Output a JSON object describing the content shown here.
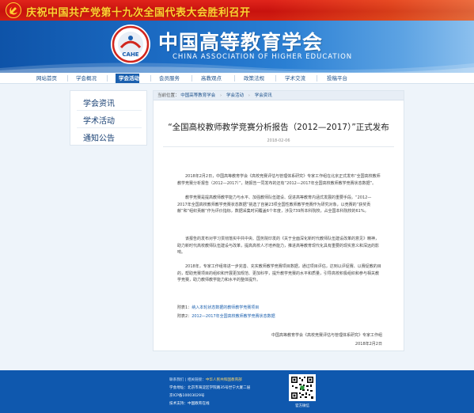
{
  "banner": {
    "text": "庆祝中国共产党第十九次全国代表大会胜利召开"
  },
  "header": {
    "title": "中国高等教育学会",
    "subtitle": "CHINA ASSOCIATION OF HIGHER EDUCATION",
    "logo_text": "CAHE"
  },
  "nav": {
    "items": [
      "网站首页",
      "学会概况",
      "学会活动",
      "会员服务",
      "高教观点",
      "政策法规",
      "学术交流",
      "投稿平台"
    ],
    "active": "学会活动"
  },
  "sidebar": {
    "items": [
      "学会资讯",
      "学术活动",
      "通知公告"
    ]
  },
  "breadcrumb": {
    "prefix": "当前位置：",
    "items": [
      "中国高等教育学会",
      "学会活动",
      "学会资讯"
    ]
  },
  "article": {
    "title": "“全国高校教师教学竞赛分析报告（2012—2017）”正式发布",
    "date": "2018-02-06",
    "paragraphs": [
      "2018年2月2日，中国高等教育学会《高校竞赛评估与管理体系研究》专家工作组在北京正式发布“全国高校教师教学竞赛分析报告（2012—2017）”，随报告一同发布的还有“2012—2017年全国高校教师教学竞赛状态数据”。",
      "教学竞赛是提高教师教学能力与水平、加强教师队伍建设、促进高等教育内涵式发展的重要手段。“2012—2017年全国高校教师教学竞赛状态数据”挑选了自第23项全国性教师教学竞赛作为研究对象，以竞赛的“获奖贡献”和“组织贡献”作为评价指标，数据采集时间覆盖6个年度，涉及739所本科院校，占全国本科院校的61%。",
      "该报告的发布对学习贯彻落实中共中央、国务院印发的《关于全面深化新时代教师队伍建设改革的意见》精神，助力新时代高校教师队伍建设与改革，提高高校人才培养能力，推进高等教育现代化具有重要的现实意义和深远的影响。",
      "2018年，专家工作组将进一步完善、充实教师教学竞赛项目数据，通过项目评估，达到以评促赛、以赛促教的目的，帮助竞赛项目的组织和开展更加规范、更加科学，提升教学竞赛的水平和质量，引导高校积极组织和参与相关教学竞赛，助力教师教学能力和水平的整体提升。"
    ],
    "attachments": [
      {
        "prefix": "附表1：",
        "link": "纳入本轮状态数据的教师教学竞赛项目"
      },
      {
        "prefix": "附表2：",
        "link": "2012—2017年全国高校教师教学竞赛状态数据"
      }
    ],
    "signature": "中国高等教育学会《高校竞赛评估与管理体系研究》专家工作组",
    "sign_date": "2018年2月2日"
  },
  "footer": {
    "links_label": "联系我们 | 相关链接：",
    "links_value": "中华人民共和国教育部",
    "address_label": "学会地址：",
    "address_value": "北京市海淀区学院路35号世宁大厦二层",
    "icp": "京ICP备10003029号",
    "tech_label": "技术支持：",
    "tech_value": "中国教育在线",
    "qr_label": "官方微信"
  },
  "colors": {
    "banner_red": "#c8120e",
    "banner_text": "#ffd233",
    "header_blue": "#1c6cc4",
    "nav_active": "#1a5fae",
    "footer_blue": "#0f58ae",
    "link_blue": "#1a5fae"
  }
}
